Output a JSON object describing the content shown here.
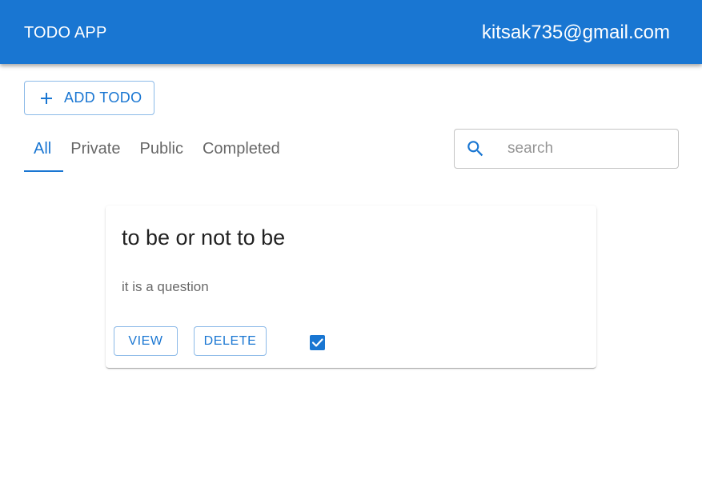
{
  "appbar": {
    "title": "TODO APP",
    "user_email": "kitsak735@gmail.com"
  },
  "toolbar": {
    "add_label": "ADD TODO",
    "add_icon": "plus-icon"
  },
  "tabs": [
    {
      "label": "All",
      "active": true
    },
    {
      "label": "Private",
      "active": false
    },
    {
      "label": "Public",
      "active": false
    },
    {
      "label": "Completed",
      "active": false
    }
  ],
  "search": {
    "placeholder": "search",
    "value": "",
    "icon": "search-icon"
  },
  "todos": [
    {
      "title": "to be or not to be",
      "description": "it is a question",
      "view_label": "VIEW",
      "delete_label": "DELETE",
      "completed": true
    }
  ],
  "colors": {
    "primary": "#1976d2",
    "appbar_text": "#ffffff"
  }
}
